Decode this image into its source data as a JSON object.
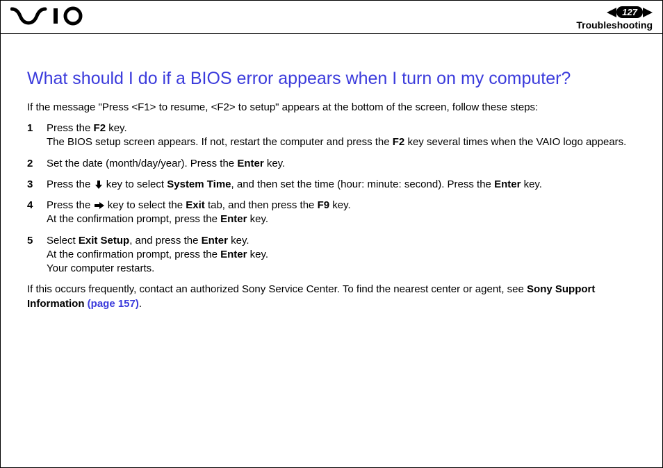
{
  "header": {
    "logo_text": "VAIO",
    "page_number": "127",
    "section": "Troubleshooting"
  },
  "title": "What should I do if a BIOS error appears when I turn on my computer?",
  "intro": "If the message \"Press <F1> to resume, <F2> to setup\" appears at the bottom of the screen, follow these steps:",
  "steps": [
    {
      "num": "1",
      "l1a": "Press the ",
      "l1b": "F2",
      "l1c": " key.",
      "l2a": "The BIOS setup screen appears. If not, restart the computer and press the ",
      "l2b": "F2",
      "l2c": " key several times when the VAIO logo appears."
    },
    {
      "num": "2",
      "l1a": "Set the date (month/day/year). Press the ",
      "l1b": "Enter",
      "l1c": " key."
    },
    {
      "num": "3",
      "l1a": "Press the ",
      "l1b_icon": "arrow-down-icon",
      "l1c": " key to select ",
      "l1d": "System Time",
      "l1e": ", and then set the time (hour: minute: second). Press the ",
      "l1f": "Enter",
      "l1g": " key."
    },
    {
      "num": "4",
      "l1a": "Press the ",
      "l1b_icon": "arrow-right-icon",
      "l1c": " key to select the ",
      "l1d": "Exit",
      "l1e": " tab, and then press the ",
      "l1f": "F9",
      "l1g": " key.",
      "l2a": "At the confirmation prompt, press the ",
      "l2b": "Enter",
      "l2c": " key."
    },
    {
      "num": "5",
      "l1a": "Select ",
      "l1b": "Exit Setup",
      "l1c": ", and press the ",
      "l1d": "Enter",
      "l1e": " key.",
      "l2a": "At the confirmation prompt, press the ",
      "l2b": "Enter",
      "l2c": " key.",
      "l3": "Your computer restarts."
    }
  ],
  "footer": {
    "a": "If this occurs frequently, contact an authorized Sony Service Center. To find the nearest center or agent, see ",
    "b": "Sony Support Information",
    "c": " ",
    "link": "(page 157)",
    "d": "."
  }
}
